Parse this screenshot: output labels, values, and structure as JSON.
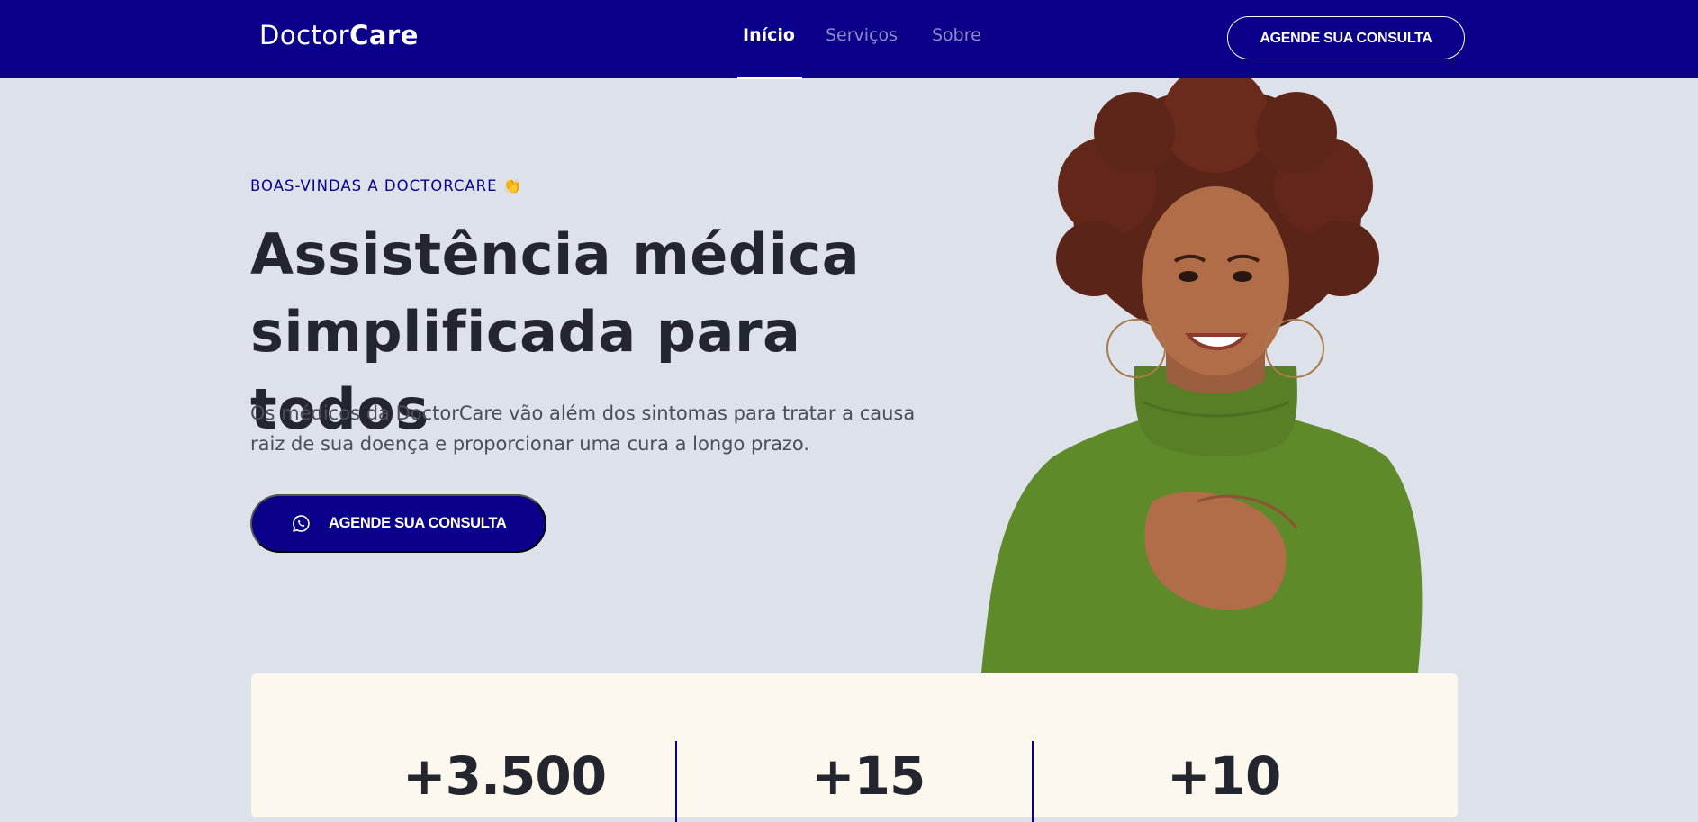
{
  "header": {
    "logo_regular": "Doctor",
    "logo_bold": "Care",
    "nav": [
      {
        "label": "Início",
        "active": true
      },
      {
        "label": "Serviços",
        "active": false
      },
      {
        "label": "Sobre",
        "active": false
      }
    ],
    "cta_label": "AGENDE SUA CONSULTA"
  },
  "hero": {
    "eyebrow": "BOAS-VINDAS A DOCTORCARE",
    "eyebrow_emoji": "👏",
    "title": "Assistência médica simplificada para todos",
    "description": "Os médicos da DoctorCare vão além dos sintomas para tratar a causa raiz de sua doença e proporcionar uma cura a longo prazo.",
    "cta_label": "AGENDE SUA CONSULTA",
    "cta_icon": "whatsapp-icon",
    "image": "smiling-woman-green-turtleneck"
  },
  "stats": [
    {
      "value": "+3.500"
    },
    {
      "value": "+15"
    },
    {
      "value": "+10"
    }
  ],
  "colors": {
    "brand": "#0b008a",
    "background": "#dde1ea",
    "card": "#fdf8ee",
    "text": "#23262e"
  }
}
